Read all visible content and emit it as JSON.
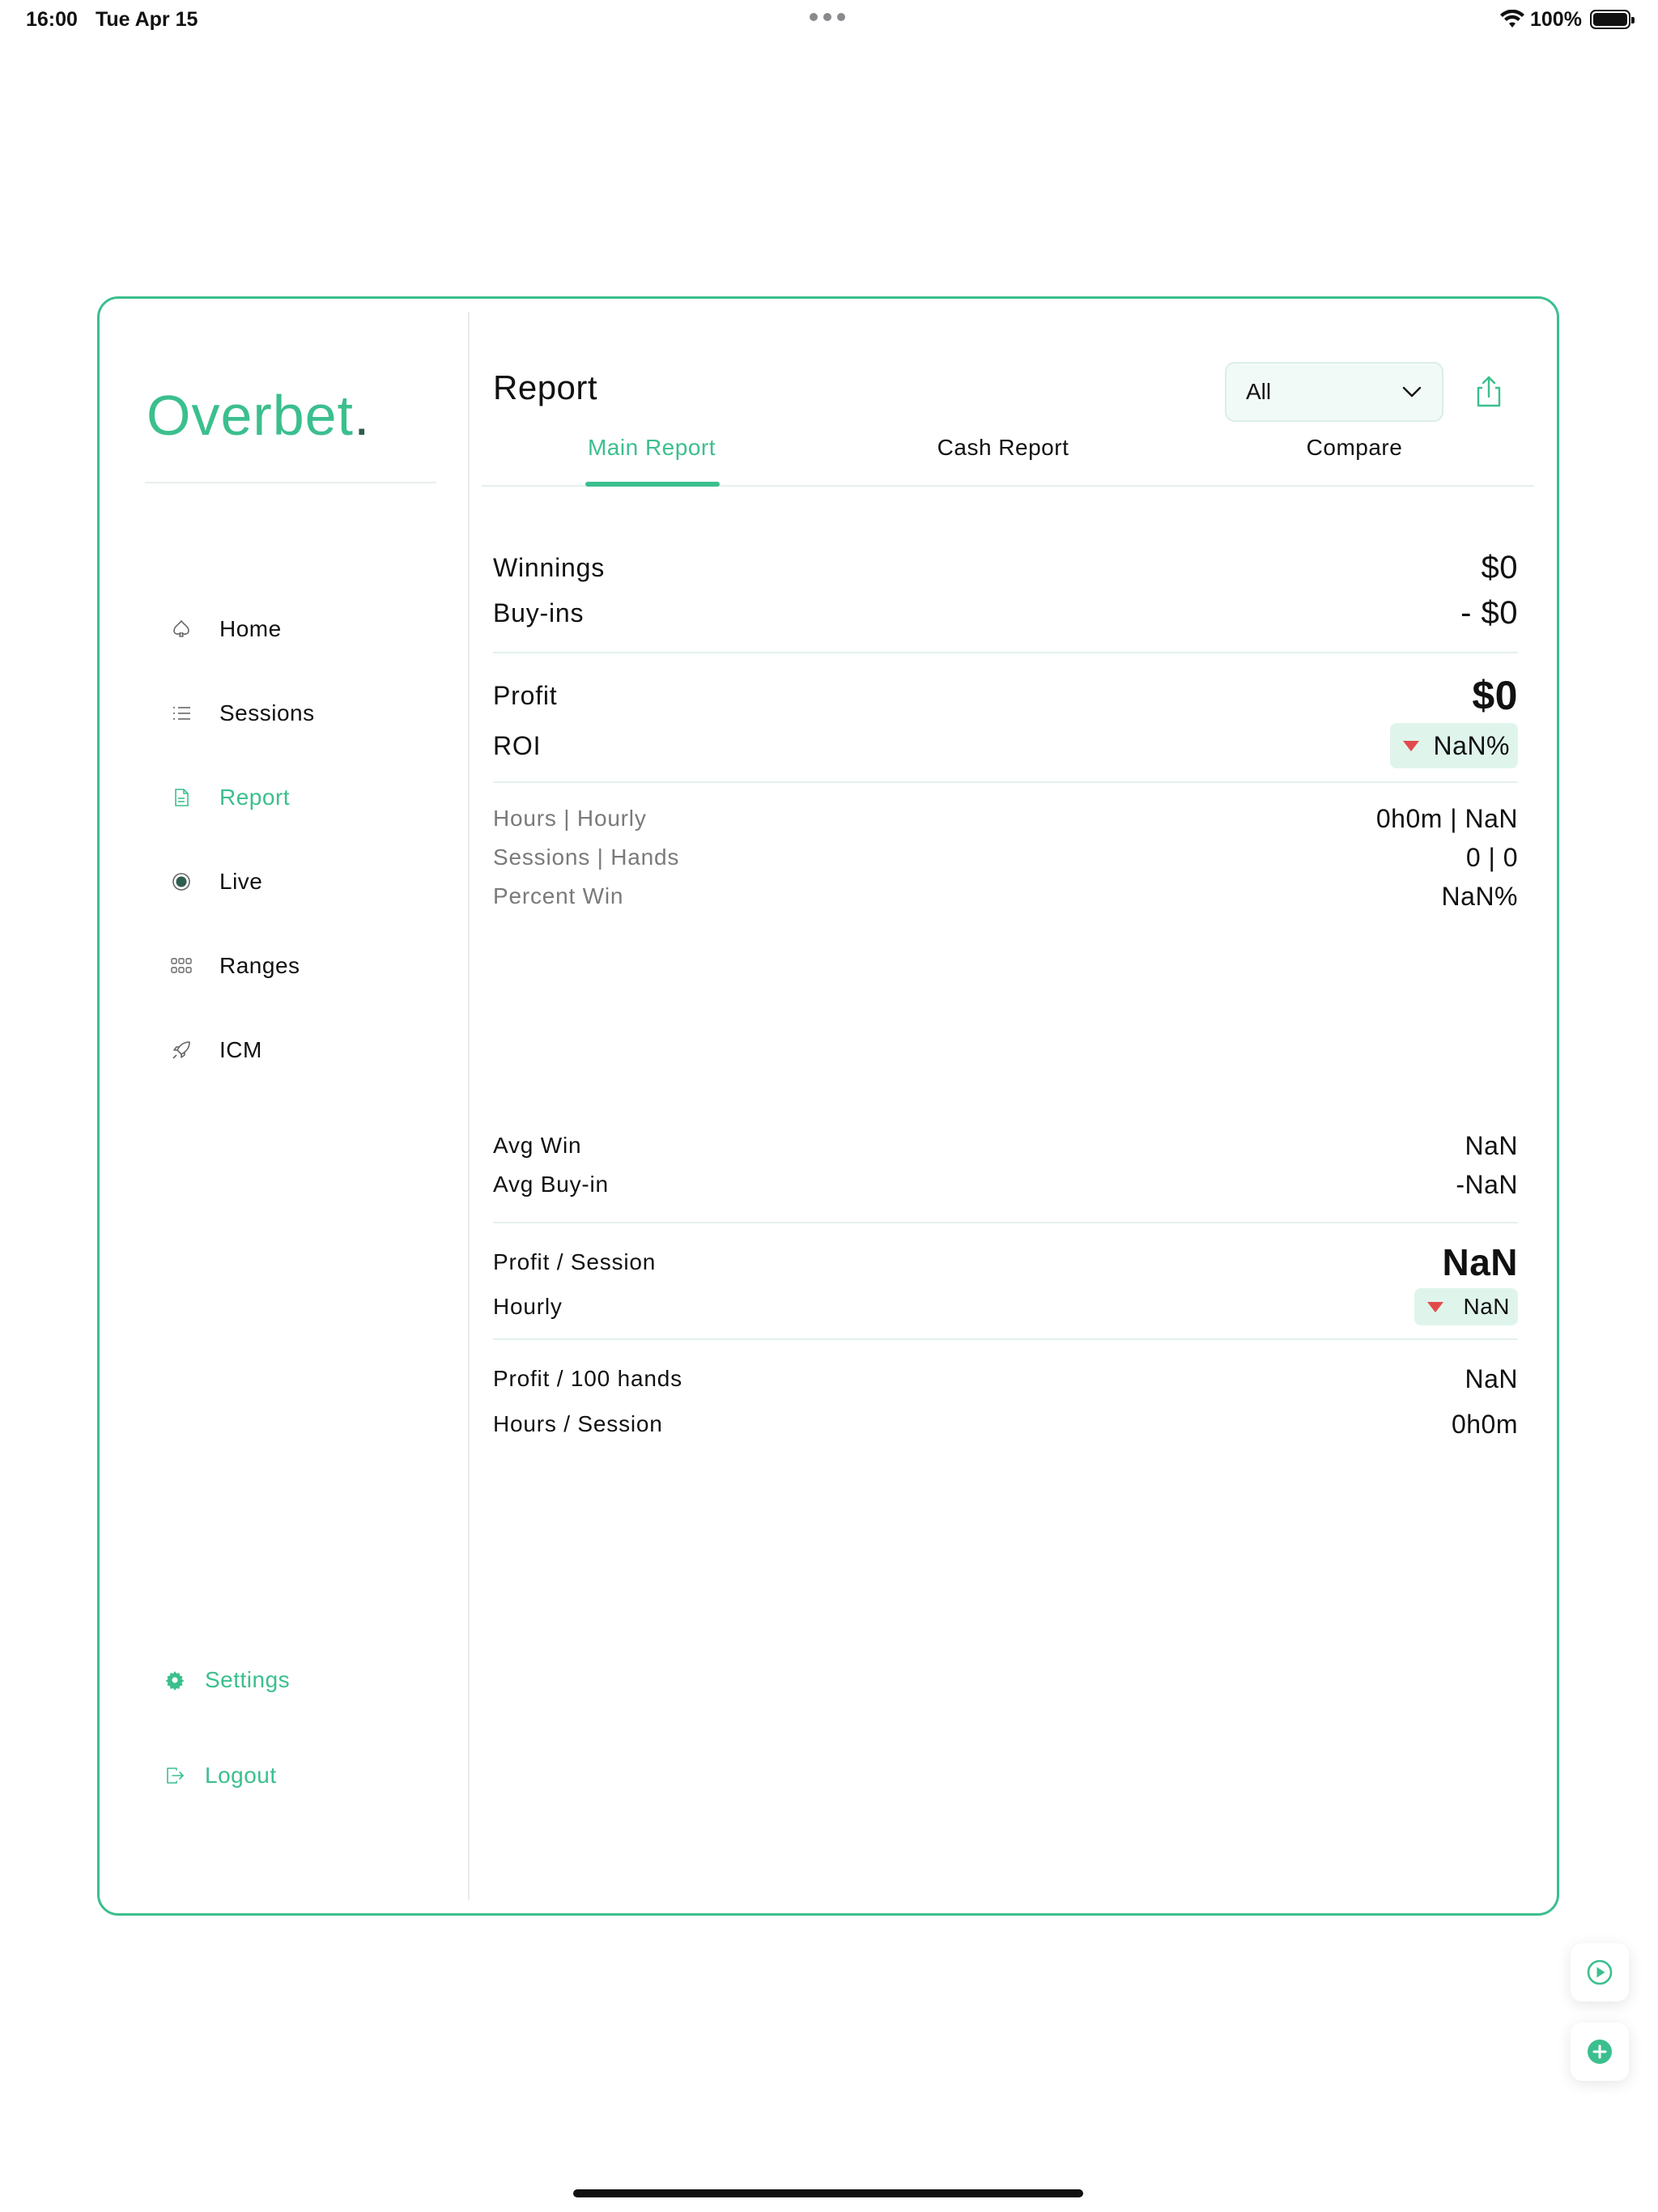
{
  "status_bar": {
    "time": "16:00",
    "date": "Tue Apr 15",
    "battery": "100%"
  },
  "brand": {
    "name": "Overbet",
    "dot": ".",
    "accent_color": "#3bbf8e"
  },
  "sidebar": {
    "items": [
      {
        "label": "Home",
        "icon": "spade-icon"
      },
      {
        "label": "Sessions",
        "icon": "list-icon"
      },
      {
        "label": "Report",
        "icon": "document-icon",
        "active": true
      },
      {
        "label": "Live",
        "icon": "radio-icon"
      },
      {
        "label": "Ranges",
        "icon": "grid-icon"
      },
      {
        "label": "ICM",
        "icon": "rocket-icon"
      }
    ],
    "settings_label": "Settings",
    "logout_label": "Logout"
  },
  "header": {
    "title": "Report",
    "filter_value": "All"
  },
  "tabs": [
    {
      "label": "Main Report",
      "active": true
    },
    {
      "label": "Cash Report"
    },
    {
      "label": "Compare"
    }
  ],
  "report": {
    "winnings": {
      "label": "Winnings",
      "value": "$0"
    },
    "buyins": {
      "label": "Buy-ins",
      "value": "- $0"
    },
    "profit": {
      "label": "Profit",
      "value": "$0"
    },
    "roi": {
      "label": "ROI",
      "value": "NaN%"
    },
    "hours_hourly": {
      "label": "Hours | Hourly",
      "value": "0h0m | NaN"
    },
    "sessions_hands": {
      "label": "Sessions | Hands",
      "value": "0 | 0"
    },
    "percent_win": {
      "label": "Percent Win",
      "value": "NaN%"
    },
    "avg_win": {
      "label": "Avg Win",
      "value": "NaN"
    },
    "avg_buyin": {
      "label": "Avg Buy-in",
      "value": "-NaN"
    },
    "profit_session": {
      "label": "Profit / Session",
      "value": "NaN"
    },
    "hourly": {
      "label": "Hourly",
      "value": "NaN"
    },
    "profit_100": {
      "label": "Profit / 100 hands",
      "value": "NaN"
    },
    "hours_session": {
      "label": "Hours / Session",
      "value": "0h0m"
    }
  }
}
